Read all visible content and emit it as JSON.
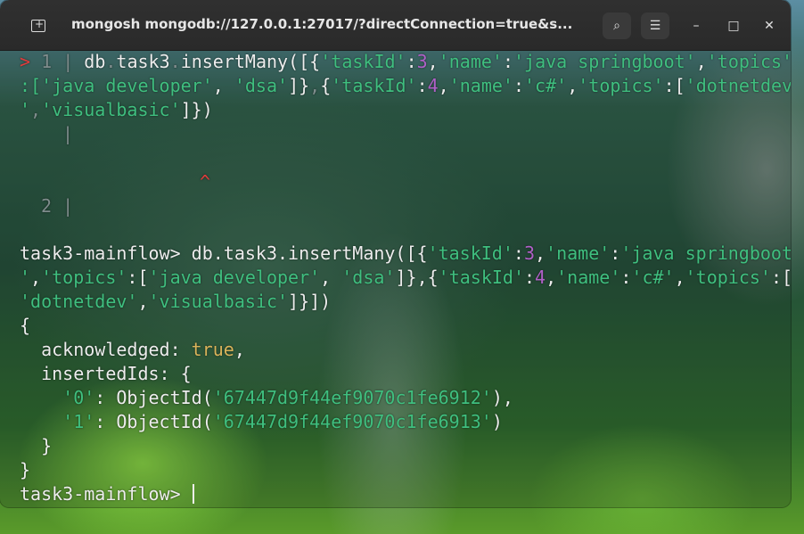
{
  "window": {
    "title": "mongosh mongodb://127.0.0.1:27017/?directConnection=true&s...",
    "new_tab_icon": "new-tab-icon",
    "search_icon": "⌕",
    "menu_icon": "☰",
    "minimize_icon": "–",
    "maximize_icon": "□",
    "close_icon": "✕"
  },
  "terminal": {
    "editor": {
      "prompt_marker": ">",
      "line1_num": "1",
      "line2_num": "2",
      "gutter_bar": "|",
      "line1": {
        "t1": "db",
        "t2": ".",
        "t3": "task3",
        "t4": ".",
        "t5": "insertMany([{",
        "t6": "'taskId'",
        "t7": ":",
        "t8": "3",
        "t9": ",",
        "t10": "'name'",
        "t11": ":",
        "t12": "'java springboot'",
        "t13": ",",
        "t14": "'topics'"
      },
      "line2": {
        "t1": ":[",
        "t2": "'java developer'",
        "t3": ", ",
        "t4": "'dsa'",
        "t5": "]}",
        "t6": ",",
        "t7": "{",
        "t8": "'taskId'",
        "t9": ":",
        "t10": "4",
        "t11": ",",
        "t12": "'name'",
        "t13": ":",
        "t14": "'c#'",
        "t15": ",",
        "t16": "'topics'",
        "t17": ":[",
        "t18": "'dotnetdev"
      },
      "line3": {
        "t1": "'",
        "t2": ",",
        "t3": "'visualbasic'",
        "t4": "]})"
      },
      "caret_marker": "^"
    },
    "history": {
      "prompt": "task3-mainflow> ",
      "cmd1": {
        "t1": "db.task3.insertMany([{",
        "t2": "'taskId'",
        "t3": ":",
        "t4": "3",
        "t5": ",",
        "t6": "'name'",
        "t7": ":",
        "t8": "'java springboot"
      },
      "cmd2": {
        "t1": "'",
        "t2": ",",
        "t3": "'topics'",
        "t4": ":[",
        "t5": "'java developer'",
        "t6": ", ",
        "t7": "'dsa'",
        "t8": "]},{",
        "t9": "'taskId'",
        "t10": ":",
        "t11": "4",
        "t12": ",",
        "t13": "'name'",
        "t14": ":",
        "t15": "'c#'",
        "t16": ",",
        "t17": "'topics'",
        "t18": ":["
      },
      "cmd3": {
        "t1": "'dotnetdev'",
        "t2": ",",
        "t3": "'visualbasic'",
        "t4": "]}])"
      }
    },
    "output": {
      "open_brace": "{",
      "ack_key": "  acknowledged: ",
      "ack_val": "true",
      "ack_comma": ",",
      "ids_line": "  insertedIds: {",
      "id0_key": "'0'",
      "id0_mid": ": ObjectId(",
      "id0_val": "'67447d9f44ef9070c1fe6912'",
      "id0_end": "),",
      "id1_key": "'1'",
      "id1_mid": ": ObjectId(",
      "id1_val": "'67447d9f44ef9070c1fe6913'",
      "id1_end": ")",
      "inner_close": "  }",
      "outer_close": "}"
    },
    "final_prompt": "task3-mainflow> "
  },
  "colors": {
    "string": "#3fbf7f",
    "number": "#b060c8",
    "boolean": "#d9b35a",
    "error_marker": "#e03c3c",
    "titlebar": "#2c2c2c"
  }
}
